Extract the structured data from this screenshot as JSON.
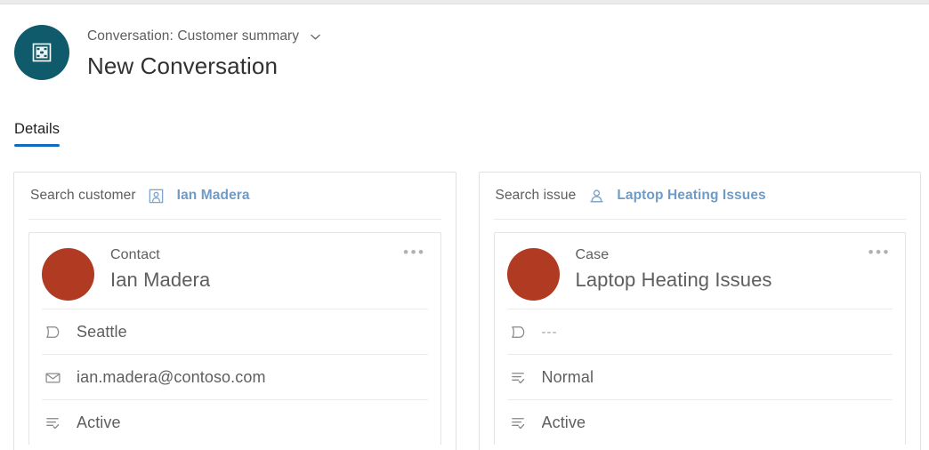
{
  "header": {
    "avatar_icon": "conversation-icon",
    "avatar_color": "#105b6b",
    "subtitle": "Conversation: Customer summary",
    "dropdown_icon": "chevron-down-icon",
    "title": "New Conversation"
  },
  "tabs": [
    {
      "label": "Details",
      "active": true,
      "accent": "#0f6cbd"
    }
  ],
  "cards": [
    {
      "id": "customer-card",
      "search": {
        "label": "Search customer",
        "entity_icon": "contact-icon",
        "link_text": "Ian Madera",
        "link_color": "#6f9cc6"
      },
      "record": {
        "avatar_color": "#b03a22",
        "type": "Contact",
        "name": "Ian Madera",
        "overflow_icon": "more-options-icon",
        "rows": [
          {
            "icon": "location-icon",
            "value": "Seattle",
            "muted": false
          },
          {
            "icon": "email-icon",
            "value": "ian.madera@contoso.com",
            "muted": false
          },
          {
            "icon": "status-icon",
            "value": "Active",
            "muted": false
          }
        ]
      }
    },
    {
      "id": "issue-card",
      "search": {
        "label": "Search issue",
        "entity_icon": "case-icon",
        "link_text": "Laptop Heating Issues",
        "link_color": "#6f9cc6"
      },
      "record": {
        "avatar_color": "#b03a22",
        "type": "Case",
        "name": "Laptop Heating Issues",
        "overflow_icon": "more-options-icon",
        "rows": [
          {
            "icon": "location-icon",
            "value": "---",
            "muted": true
          },
          {
            "icon": "status-icon",
            "value": "Normal",
            "muted": false
          },
          {
            "icon": "status-icon",
            "value": "Active",
            "muted": false
          }
        ]
      }
    }
  ]
}
